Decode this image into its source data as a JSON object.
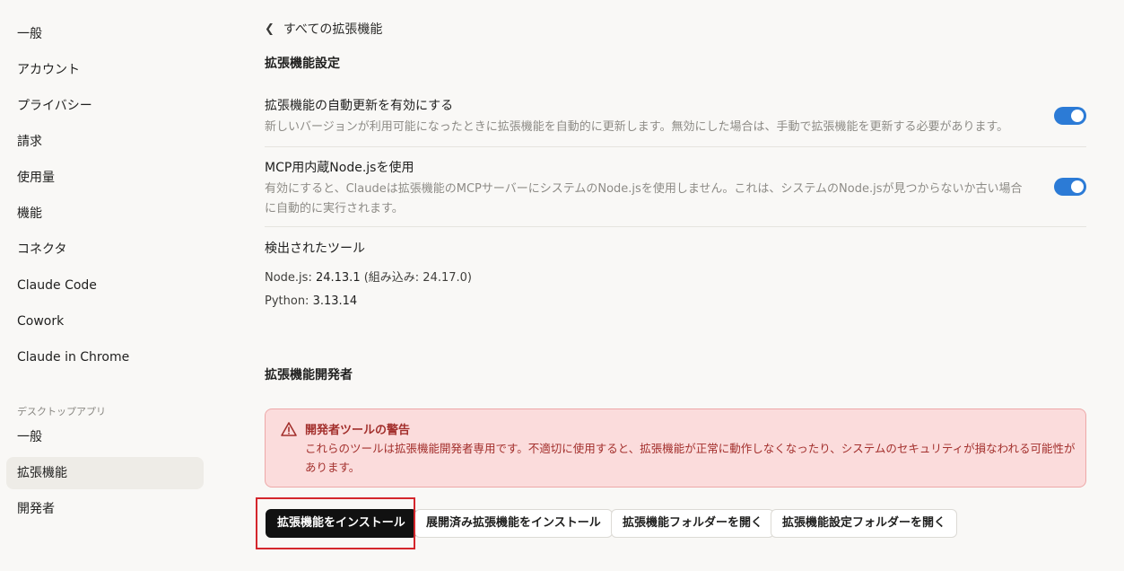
{
  "sidebar": {
    "items": [
      {
        "label": "一般"
      },
      {
        "label": "アカウント"
      },
      {
        "label": "プライバシー"
      },
      {
        "label": "請求"
      },
      {
        "label": "使用量"
      },
      {
        "label": "機能"
      },
      {
        "label": "コネクタ"
      },
      {
        "label": "Claude Code"
      },
      {
        "label": "Cowork"
      },
      {
        "label": "Claude in Chrome"
      }
    ],
    "section_label": "デスクトップアプリ",
    "desktop_items": [
      {
        "label": "一般"
      },
      {
        "label": "拡張機能",
        "active": true
      },
      {
        "label": "開発者"
      }
    ]
  },
  "main": {
    "back_label": "すべての拡張機能",
    "settings_title": "拡張機能設定",
    "auto_update": {
      "label": "拡張機能の自動更新を有効にする",
      "description": "新しいバージョンが利用可能になったときに拡張機能を自動的に更新します。無効にした場合は、手動で拡張機能を更新する必要があります。",
      "enabled": true
    },
    "builtin_node": {
      "label": "MCP用内蔵Node.jsを使用",
      "description": "有効にすると、Claudeは拡張機能のMCPサーバーにシステムのNode.jsを使用しません。これは、システムのNode.jsが見つからないか古い場合に自動的に実行されます。",
      "enabled": true
    },
    "detected_tools": {
      "title": "検出されたツール",
      "node_label": "Node.js: ",
      "node_value": "24.13.1",
      "node_builtin": " (組み込み: 24.17.0)",
      "python_label": "Python: ",
      "python_value": "3.13.14"
    },
    "developer_title": "拡張機能開発者",
    "warning": {
      "title": "開発者ツールの警告",
      "text": "これらのツールは拡張機能開発者専用です。不適切に使用すると、拡張機能が正常に動作しなくなったり、システムのセキュリティが損なわれる可能性があります。"
    },
    "buttons": {
      "install": "拡張機能をインストール",
      "install_unpacked": "展開済み拡張機能をインストール",
      "open_folder": "拡張機能フォルダーを開く",
      "open_settings_folder": "拡張機能設定フォルダーを開く"
    }
  },
  "colors": {
    "toggle_on": "#2c7bd6",
    "warning_bg": "#fbdcdc",
    "warning_text": "#a3302d",
    "highlight": "#d4262c"
  }
}
